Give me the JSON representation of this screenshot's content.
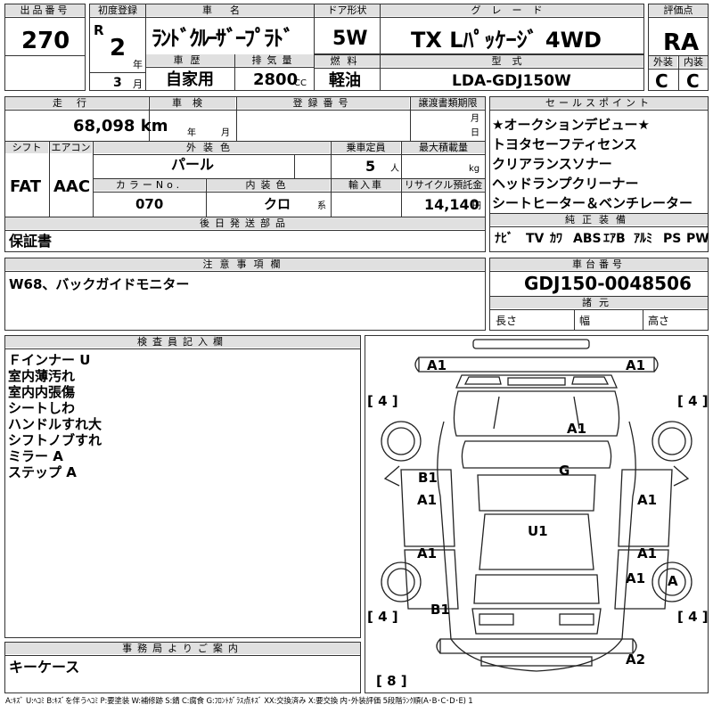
{
  "header_row": {
    "lot_label": "出品番号",
    "lot_value": "270",
    "first_reg_label": "初度登録",
    "era": "R",
    "year_value": "2",
    "year_unit": "年",
    "month_value": "3",
    "month_unit": "月",
    "car_name_label": "車名",
    "car_name": "ﾗﾝﾄﾞｸﾙｰｻﾞｰﾌﾟﾗﾄﾞ",
    "doors_label": "ドア形状",
    "doors": "5W",
    "grade_label": "グレード",
    "grade": "TX Lﾊﾟｯｹｰｼﾞ 4WD",
    "score_label": "評価点",
    "score": "RA",
    "history_label": "車歴",
    "history": "自家用",
    "displacement_label": "排気量",
    "displacement": "2800",
    "displacement_unit": "CC",
    "fuel_label": "燃料",
    "fuel": "軽油",
    "model_label": "型式",
    "model": "LDA-GDJ150W",
    "exterior_label": "外装",
    "exterior": "C",
    "interior_label": "内装",
    "interior": "C"
  },
  "second_block": {
    "mileage_label": "走行",
    "mileage": "68,098 km",
    "inspection_label": "車検",
    "insp_year_unit": "年",
    "insp_month_unit": "月",
    "plate_label": "登録番号",
    "transfer_label": "譲渡書類期限",
    "transfer_month_unit": "月",
    "transfer_day_unit": "日",
    "shift_label": "シフト",
    "shift": "FAT",
    "aircon_label": "エアコン",
    "aircon": "AAC",
    "color_label": "外装色",
    "color": "パール",
    "capacity_label": "乗車定員",
    "capacity": "5",
    "capacity_unit": "人",
    "max_load_label": "最大積載量",
    "max_load_unit": "kg",
    "color_no_label": "カラーNo.",
    "color_no": "070",
    "int_color_label": "内装色",
    "int_color": "クロ",
    "int_color_unit": "系",
    "import_label": "輸入車",
    "recycle_label": "リサイクル預託金",
    "recycle": "14,140",
    "recycle_unit": "円",
    "later_label": "後日発送部品",
    "later_value": "保証書"
  },
  "sales_points": {
    "label": "セールスポイント",
    "items": [
      "★オークションデビュー★",
      "トヨタセーフティセンス",
      "クリアランスソナー",
      "ヘッドランプクリーナー",
      "シートヒーター＆ベンチレーター"
    ]
  },
  "equipment": {
    "label": "純正装備",
    "items": [
      "ﾅﾋﾞ",
      "TV",
      "ｶﾜ",
      "ABS",
      "ｴｱB",
      "ｱﾙﾐ",
      "PS",
      "PW"
    ]
  },
  "caution": {
    "label": "注意事項欄",
    "text": "W68、バックガイドモニター"
  },
  "chassis": {
    "label": "車台番号",
    "number": "GDJ150-0048506",
    "specs_label": "諸元",
    "length_label": "長さ",
    "width_label": "幅",
    "height_label": "高さ"
  },
  "inspector": {
    "label": "検査員記入欄",
    "lines": [
      "Ｆインナー U",
      "室内薄汚れ",
      "室内内張傷",
      "シートしわ",
      "ハンドルすれ大",
      "シフトノブすれ",
      "ミラー A",
      "ステップ A"
    ]
  },
  "office": {
    "label": "事務局よりご案内",
    "text": "キーケース"
  },
  "diagram": {
    "marks": {
      "front_left": "A1",
      "front_right": "A1",
      "hood": "A1",
      "roof": "G",
      "left_front_door_a": "B1",
      "left_front_door_b": "A1",
      "left_rear_door": "A1",
      "right_front_door": "A1",
      "right_rear_door": "A1",
      "right_quarter": "A1",
      "interior": "U1",
      "left_rear": "B1",
      "spare": "A",
      "rear_bumper": "A2",
      "rear_tread": "[ 8 ]",
      "tire_fl": "[ 4 ]",
      "tire_fr": "[ 4 ]",
      "tire_rl": "[ 4 ]",
      "tire_rr": "[ 4 ]"
    }
  },
  "legend": "A:ｷｽﾞ U:ﾍｺﾐ B:ｷｽﾞを伴うﾍｺﾐ P:要塗装 W:補修跡 S:錆 C:腐食 G:ﾌﾛﾝﾄｶﾞﾗｽ点ｷｽﾞ XX:交換済み X:要交換 内･外装評価 5段階ﾗﾝｸ順(A･B･C･D･E) 1"
}
